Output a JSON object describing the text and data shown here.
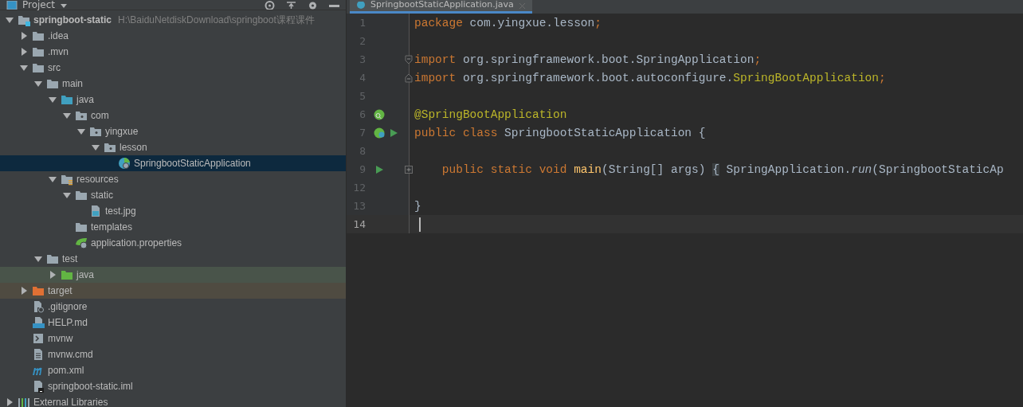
{
  "project_panel": {
    "title": "Project",
    "tree": [
      {
        "label": "springboot-static",
        "path": "H:\\BaiduNetdiskDownload\\springboot课程课件",
        "kind": "module",
        "expanded": true,
        "selected": false,
        "children": [
          {
            "label": ".idea",
            "kind": "folder",
            "expanded": false,
            "selected": false
          },
          {
            "label": ".mvn",
            "kind": "folder",
            "expanded": false,
            "selected": false
          },
          {
            "label": "src",
            "kind": "folder",
            "expanded": true,
            "selected": false,
            "children": [
              {
                "label": "main",
                "kind": "folder",
                "expanded": true,
                "selected": false,
                "children": [
                  {
                    "label": "java",
                    "kind": "source-folder",
                    "expanded": true,
                    "selected": false,
                    "children": [
                      {
                        "label": "com",
                        "kind": "package",
                        "expanded": true,
                        "selected": false,
                        "children": [
                          {
                            "label": "yingxue",
                            "kind": "package",
                            "expanded": true,
                            "selected": false,
                            "children": [
                              {
                                "label": "lesson",
                                "kind": "package",
                                "expanded": true,
                                "selected": false,
                                "children": [
                                  {
                                    "label": "SpringbootStaticApplication",
                                    "kind": "spring-class",
                                    "selected": true
                                  }
                                ]
                              }
                            ]
                          }
                        ]
                      }
                    ]
                  },
                  {
                    "label": "resources",
                    "kind": "resources-folder",
                    "expanded": true,
                    "selected": false,
                    "children": [
                      {
                        "label": "static",
                        "kind": "folder",
                        "expanded": true,
                        "selected": false,
                        "children": [
                          {
                            "label": "test.jpg",
                            "kind": "image-file",
                            "selected": false
                          }
                        ]
                      },
                      {
                        "label": "templates",
                        "kind": "folder",
                        "selected": false
                      },
                      {
                        "label": "application.properties",
                        "kind": "spring-config",
                        "selected": false
                      }
                    ]
                  }
                ]
              },
              {
                "label": "test",
                "kind": "folder",
                "expanded": true,
                "selected": false,
                "children": [
                  {
                    "label": "java",
                    "kind": "test-folder",
                    "expanded": false,
                    "selected": false,
                    "color": "#49544a"
                  }
                ]
              }
            ]
          },
          {
            "label": "target",
            "kind": "excluded-folder",
            "expanded": false,
            "selected": false,
            "color": "#4f4b41"
          },
          {
            "label": ".gitignore",
            "kind": "ignore-file",
            "selected": false
          },
          {
            "label": "HELP.md",
            "kind": "markdown-file",
            "selected": false
          },
          {
            "label": "mvnw",
            "kind": "shell-file",
            "selected": false
          },
          {
            "label": "mvnw.cmd",
            "kind": "text-file",
            "selected": false
          },
          {
            "label": "pom.xml",
            "kind": "maven-file",
            "selected": false
          },
          {
            "label": "springboot-static.iml",
            "kind": "module-file",
            "selected": false
          }
        ]
      },
      {
        "label": "External Libraries",
        "kind": "libraries",
        "expanded": false,
        "selected": false
      }
    ]
  },
  "editor": {
    "tab": {
      "label": "SpringbootStaticApplication.java",
      "selected": true
    },
    "lines": [
      {
        "number": "1",
        "current": false,
        "tokens": [
          {
            "text": "package",
            "kind": "keyword"
          },
          {
            "text": " com.yingxue.lesson",
            "kind": "plain"
          },
          {
            "text": ";",
            "kind": "keyword"
          }
        ]
      },
      {
        "number": "2",
        "current": false
      },
      {
        "number": "3",
        "current": false,
        "fold_marker": {
          "kind": "start"
        },
        "tokens": [
          {
            "text": "import",
            "kind": "keyword"
          },
          {
            "text": " org.springframework.boot.SpringApplication",
            "kind": "plain"
          },
          {
            "text": ";",
            "kind": "keyword"
          }
        ]
      },
      {
        "number": "4",
        "current": false,
        "fold_marker": {
          "kind": "end"
        },
        "tokens": [
          {
            "text": "import",
            "kind": "keyword"
          },
          {
            "text": " org.springframework.boot.autoconfigure.",
            "kind": "plain"
          },
          {
            "text": "SpringBootApplication",
            "kind": "annotation"
          },
          {
            "text": ";",
            "kind": "keyword"
          }
        ]
      },
      {
        "number": "5",
        "current": false
      },
      {
        "number": "6",
        "current": false,
        "markers": [
          {
            "kind": "spring-find"
          }
        ],
        "tokens": [
          {
            "text": "@SpringBootApplication",
            "kind": "annotation"
          }
        ]
      },
      {
        "number": "7",
        "current": false,
        "markers": [
          {
            "kind": "spring-bean"
          },
          {
            "kind": "run"
          }
        ],
        "tokens": [
          {
            "text": "public class",
            "kind": "keyword"
          },
          {
            "text": " SpringbootStaticApplication {",
            "kind": "plain"
          }
        ]
      },
      {
        "number": "8",
        "current": false
      },
      {
        "number": "9",
        "current": false,
        "markers": [
          {
            "kind": "run"
          }
        ],
        "fold_marker": {
          "kind": "collapsed"
        },
        "tokens": [
          {
            "text": "    public static void ",
            "kind": "keyword"
          },
          {
            "text": "main",
            "kind": "method"
          },
          {
            "text": "(String[] args) ",
            "kind": "plain"
          },
          {
            "text": "{",
            "kind": "folded"
          },
          {
            "text": " SpringApplication.",
            "kind": "plain"
          },
          {
            "text": "run",
            "kind": "static-call"
          },
          {
            "text": "(SpringbootStaticAp",
            "kind": "plain"
          }
        ]
      },
      {
        "number": "12",
        "current": false
      },
      {
        "number": "13",
        "current": false,
        "tokens": [
          {
            "text": "}",
            "kind": "plain"
          }
        ]
      },
      {
        "number": "14",
        "current": true
      }
    ]
  }
}
